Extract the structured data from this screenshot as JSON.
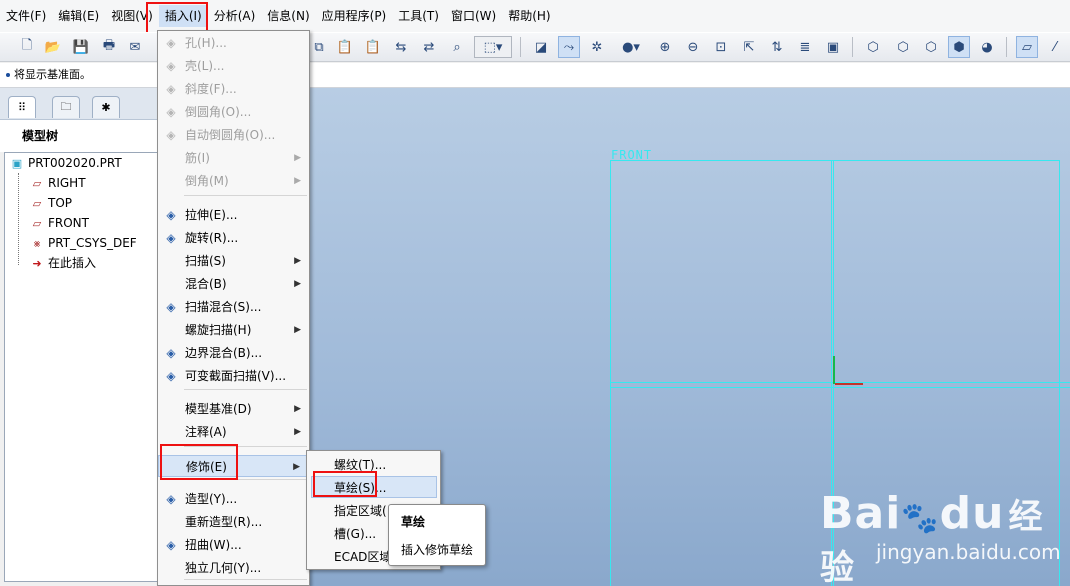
{
  "menubar": {
    "items": [
      "文件(F)",
      "编辑(E)",
      "视图(V)",
      "插入(I)",
      "分析(A)",
      "信息(N)",
      "应用程序(P)",
      "工具(T)",
      "窗口(W)",
      "帮助(H)"
    ]
  },
  "message_line": {
    "text": "将显示基准面。"
  },
  "navigator": {
    "tabs": [
      "model-tree-tab",
      "layer-tab",
      "favorites-tab"
    ],
    "tree_title": "模型树",
    "tree": {
      "root": "PRT002020.PRT",
      "children": [
        "RIGHT",
        "TOP",
        "FRONT",
        "PRT_CSYS_DEF",
        "在此插入"
      ]
    }
  },
  "graphics": {
    "datum_label": "FRONT",
    "datum_color": "#37e8ef"
  },
  "insert_menu": {
    "items": [
      {
        "label": "孔(H)...",
        "icon": "hole-icon",
        "disabled": true
      },
      {
        "label": "壳(L)...",
        "icon": "shell-icon",
        "disabled": true
      },
      {
        "label": "斜度(F)...",
        "icon": "draft-icon",
        "disabled": true
      },
      {
        "label": "倒圆角(O)...",
        "icon": "round-icon",
        "disabled": true
      },
      {
        "label": "自动倒圆角(O)...",
        "icon": "auto-round-icon",
        "disabled": true
      },
      {
        "label": "筋(I)",
        "icon": "",
        "disabled": true,
        "submenu": true
      },
      {
        "label": "倒角(M)",
        "icon": "",
        "disabled": true,
        "submenu": true
      },
      {
        "label": "拉伸(E)...",
        "icon": "extrude-icon",
        "disabled": false
      },
      {
        "label": "旋转(R)...",
        "icon": "revolve-icon",
        "disabled": false
      },
      {
        "label": "扫描(S)",
        "icon": "",
        "disabled": false,
        "submenu": true
      },
      {
        "label": "混合(B)",
        "icon": "",
        "disabled": false,
        "submenu": true
      },
      {
        "label": "扫描混合(S)...",
        "icon": "swept-blend-icon",
        "disabled": false
      },
      {
        "label": "螺旋扫描(H)",
        "icon": "",
        "disabled": false,
        "submenu": true
      },
      {
        "label": "边界混合(B)...",
        "icon": "boundary-blend-icon",
        "disabled": false
      },
      {
        "label": "可变截面扫描(V)...",
        "icon": "var-sect-sweep-icon",
        "disabled": false
      },
      {
        "label": "模型基准(D)",
        "icon": "",
        "disabled": false,
        "submenu": true
      },
      {
        "label": "注释(A)",
        "icon": "",
        "disabled": false,
        "submenu": true
      },
      {
        "label": "修饰(E)",
        "icon": "",
        "disabled": false,
        "submenu": true
      },
      {
        "label": "造型(Y)...",
        "icon": "style-icon",
        "disabled": false
      },
      {
        "label": "重新造型(R)...",
        "icon": "",
        "disabled": false
      },
      {
        "label": "扭曲(W)...",
        "icon": "warp-icon",
        "disabled": false
      },
      {
        "label": "独立几何(Y)...",
        "icon": "",
        "disabled": false
      }
    ]
  },
  "cosmetic_submenu": {
    "items": [
      "螺纹(T)...",
      "草绘(S)...",
      "指定区域(",
      "槽(G)...",
      "ECAD区域"
    ]
  },
  "tooltip": {
    "title": "草绘",
    "description": "插入修饰草绘"
  },
  "watermark": {
    "brand": "Bai",
    "brand2": "du",
    "brand_cn": "经验",
    "url": "jingyan.baidu.com"
  }
}
